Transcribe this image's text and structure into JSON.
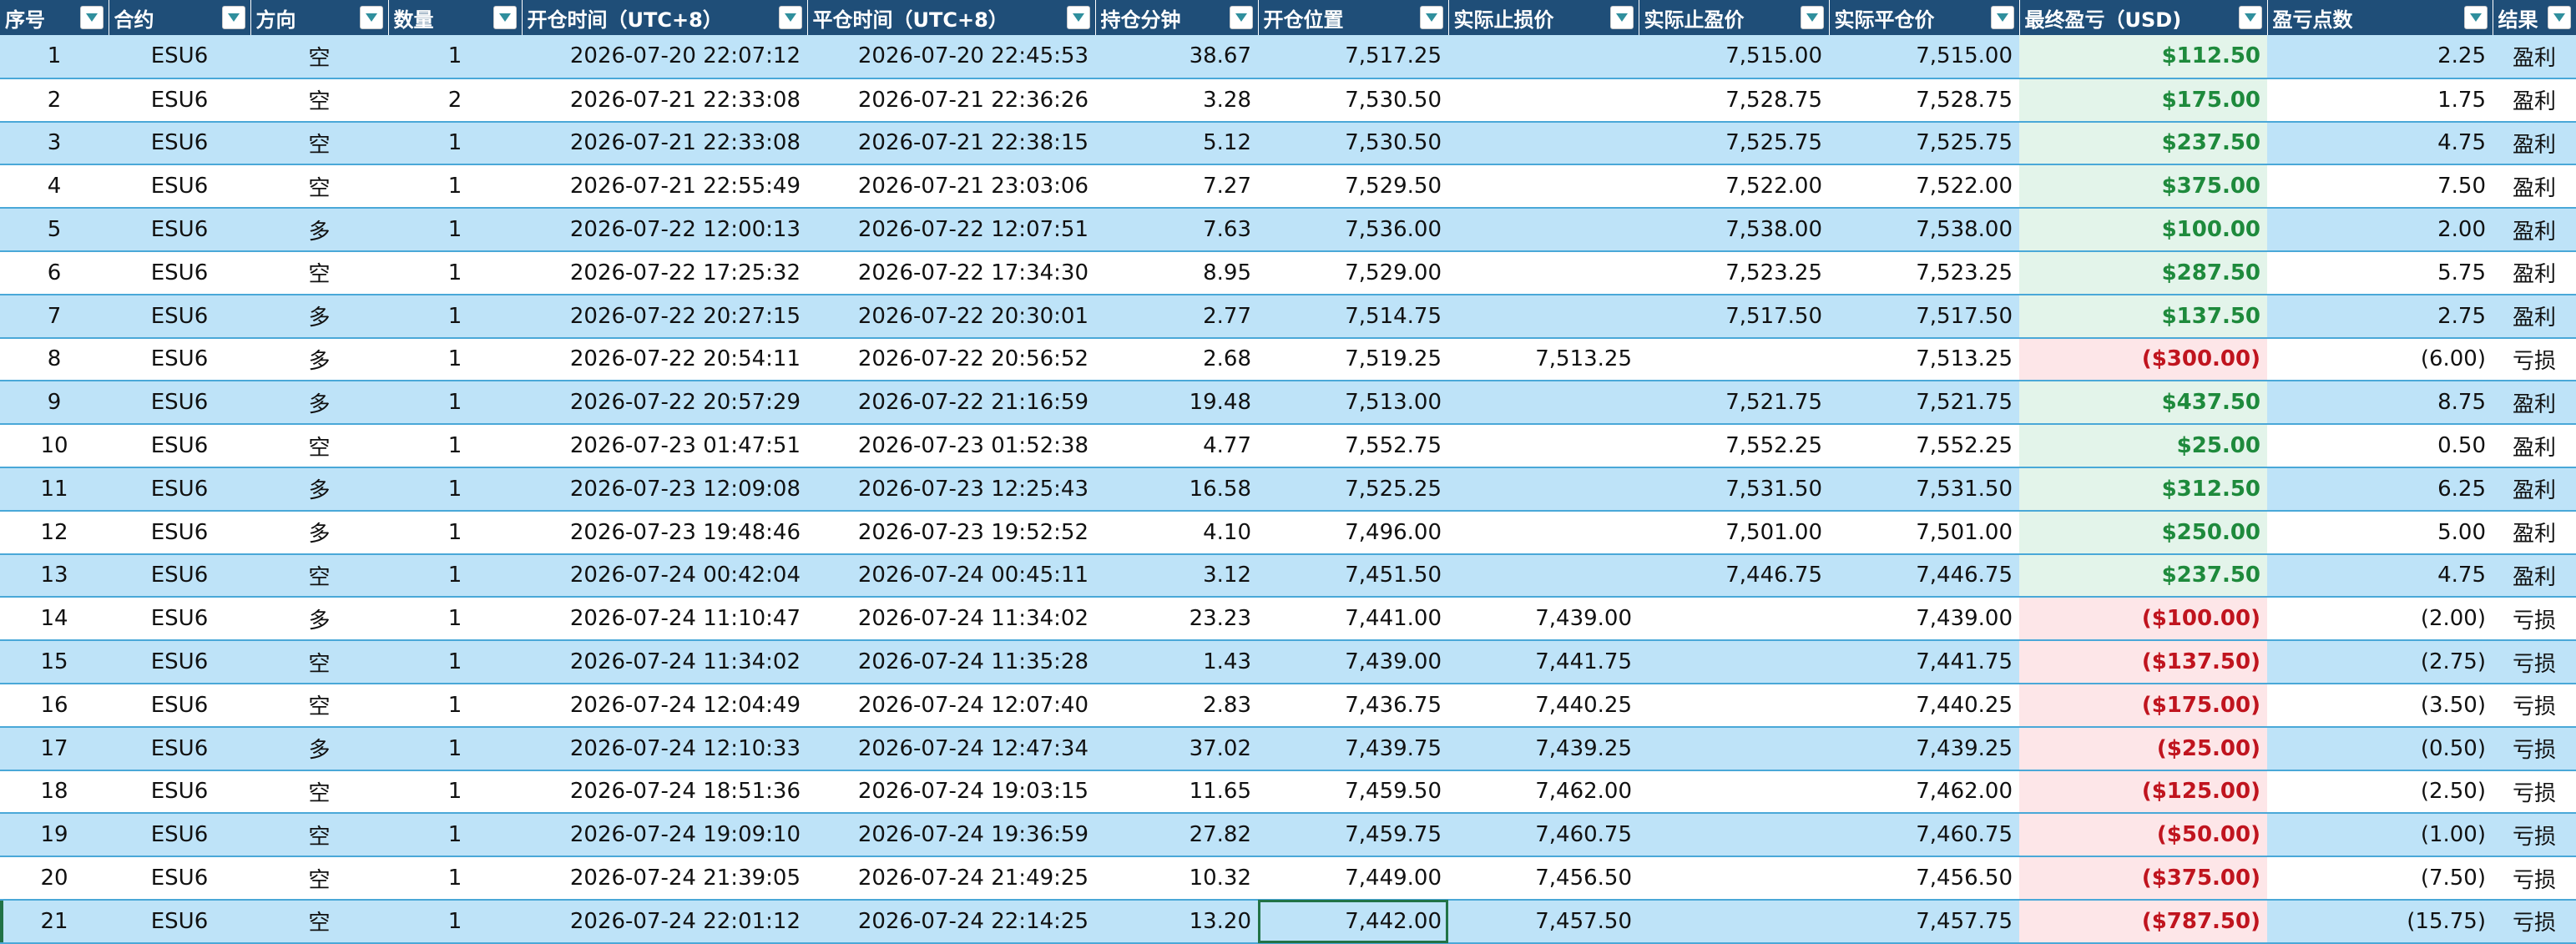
{
  "columns": [
    {
      "key": "seq",
      "label": "序号",
      "align": "c"
    },
    {
      "key": "contract",
      "label": "合约",
      "align": "c"
    },
    {
      "key": "direction",
      "label": "方向",
      "align": "c"
    },
    {
      "key": "qty",
      "label": "数量",
      "align": "c"
    },
    {
      "key": "open_time",
      "label": "开仓时间（UTC+8）",
      "align": "r"
    },
    {
      "key": "close_time",
      "label": "平仓时间（UTC+8）",
      "align": "r"
    },
    {
      "key": "hold_min",
      "label": "持仓分钟",
      "align": "r"
    },
    {
      "key": "open_price",
      "label": "开仓位置",
      "align": "r"
    },
    {
      "key": "stop_loss",
      "label": "实际止损价",
      "align": "r"
    },
    {
      "key": "take_profit",
      "label": "实际止盈价",
      "align": "r"
    },
    {
      "key": "close_price",
      "label": "实际平仓价",
      "align": "r"
    },
    {
      "key": "pnl",
      "label": "最终盈亏（USD)",
      "align": "r"
    },
    {
      "key": "pts",
      "label": "盈亏点数",
      "align": "r"
    },
    {
      "key": "result",
      "label": "结果",
      "align": "c"
    }
  ],
  "rows": [
    {
      "seq": "1",
      "contract": "ESU6",
      "direction": "空",
      "qty": "1",
      "open_time": "2026-07-20 22:07:12",
      "close_time": "2026-07-20 22:45:53",
      "hold_min": "38.67",
      "open_price": "7,517.25",
      "stop_loss": "",
      "take_profit": "7,515.00",
      "close_price": "7,515.00",
      "pnl": "$112.50",
      "pts": "2.25",
      "result": "盈利"
    },
    {
      "seq": "2",
      "contract": "ESU6",
      "direction": "空",
      "qty": "2",
      "open_time": "2026-07-21 22:33:08",
      "close_time": "2026-07-21 22:36:26",
      "hold_min": "3.28",
      "open_price": "7,530.50",
      "stop_loss": "",
      "take_profit": "7,528.75",
      "close_price": "7,528.75",
      "pnl": "$175.00",
      "pts": "1.75",
      "result": "盈利"
    },
    {
      "seq": "3",
      "contract": "ESU6",
      "direction": "空",
      "qty": "1",
      "open_time": "2026-07-21 22:33:08",
      "close_time": "2026-07-21 22:38:15",
      "hold_min": "5.12",
      "open_price": "7,530.50",
      "stop_loss": "",
      "take_profit": "7,525.75",
      "close_price": "7,525.75",
      "pnl": "$237.50",
      "pts": "4.75",
      "result": "盈利"
    },
    {
      "seq": "4",
      "contract": "ESU6",
      "direction": "空",
      "qty": "1",
      "open_time": "2026-07-21 22:55:49",
      "close_time": "2026-07-21 23:03:06",
      "hold_min": "7.27",
      "open_price": "7,529.50",
      "stop_loss": "",
      "take_profit": "7,522.00",
      "close_price": "7,522.00",
      "pnl": "$375.00",
      "pts": "7.50",
      "result": "盈利"
    },
    {
      "seq": "5",
      "contract": "ESU6",
      "direction": "多",
      "qty": "1",
      "open_time": "2026-07-22 12:00:13",
      "close_time": "2026-07-22 12:07:51",
      "hold_min": "7.63",
      "open_price": "7,536.00",
      "stop_loss": "",
      "take_profit": "7,538.00",
      "close_price": "7,538.00",
      "pnl": "$100.00",
      "pts": "2.00",
      "result": "盈利"
    },
    {
      "seq": "6",
      "contract": "ESU6",
      "direction": "空",
      "qty": "1",
      "open_time": "2026-07-22 17:25:32",
      "close_time": "2026-07-22 17:34:30",
      "hold_min": "8.95",
      "open_price": "7,529.00",
      "stop_loss": "",
      "take_profit": "7,523.25",
      "close_price": "7,523.25",
      "pnl": "$287.50",
      "pts": "5.75",
      "result": "盈利"
    },
    {
      "seq": "7",
      "contract": "ESU6",
      "direction": "多",
      "qty": "1",
      "open_time": "2026-07-22 20:27:15",
      "close_time": "2026-07-22 20:30:01",
      "hold_min": "2.77",
      "open_price": "7,514.75",
      "stop_loss": "",
      "take_profit": "7,517.50",
      "close_price": "7,517.50",
      "pnl": "$137.50",
      "pts": "2.75",
      "result": "盈利"
    },
    {
      "seq": "8",
      "contract": "ESU6",
      "direction": "多",
      "qty": "1",
      "open_time": "2026-07-22 20:54:11",
      "close_time": "2026-07-22 20:56:52",
      "hold_min": "2.68",
      "open_price": "7,519.25",
      "stop_loss": "7,513.25",
      "take_profit": "",
      "close_price": "7,513.25",
      "pnl": "($300.00)",
      "pts": "(6.00)",
      "result": "亏损"
    },
    {
      "seq": "9",
      "contract": "ESU6",
      "direction": "多",
      "qty": "1",
      "open_time": "2026-07-22 20:57:29",
      "close_time": "2026-07-22 21:16:59",
      "hold_min": "19.48",
      "open_price": "7,513.00",
      "stop_loss": "",
      "take_profit": "7,521.75",
      "close_price": "7,521.75",
      "pnl": "$437.50",
      "pts": "8.75",
      "result": "盈利"
    },
    {
      "seq": "10",
      "contract": "ESU6",
      "direction": "空",
      "qty": "1",
      "open_time": "2026-07-23 01:47:51",
      "close_time": "2026-07-23 01:52:38",
      "hold_min": "4.77",
      "open_price": "7,552.75",
      "stop_loss": "",
      "take_profit": "7,552.25",
      "close_price": "7,552.25",
      "pnl": "$25.00",
      "pts": "0.50",
      "result": "盈利"
    },
    {
      "seq": "11",
      "contract": "ESU6",
      "direction": "多",
      "qty": "1",
      "open_time": "2026-07-23 12:09:08",
      "close_time": "2026-07-23 12:25:43",
      "hold_min": "16.58",
      "open_price": "7,525.25",
      "stop_loss": "",
      "take_profit": "7,531.50",
      "close_price": "7,531.50",
      "pnl": "$312.50",
      "pts": "6.25",
      "result": "盈利"
    },
    {
      "seq": "12",
      "contract": "ESU6",
      "direction": "多",
      "qty": "1",
      "open_time": "2026-07-23 19:48:46",
      "close_time": "2026-07-23 19:52:52",
      "hold_min": "4.10",
      "open_price": "7,496.00",
      "stop_loss": "",
      "take_profit": "7,501.00",
      "close_price": "7,501.00",
      "pnl": "$250.00",
      "pts": "5.00",
      "result": "盈利"
    },
    {
      "seq": "13",
      "contract": "ESU6",
      "direction": "空",
      "qty": "1",
      "open_time": "2026-07-24 00:42:04",
      "close_time": "2026-07-24 00:45:11",
      "hold_min": "3.12",
      "open_price": "7,451.50",
      "stop_loss": "",
      "take_profit": "7,446.75",
      "close_price": "7,446.75",
      "pnl": "$237.50",
      "pts": "4.75",
      "result": "盈利"
    },
    {
      "seq": "14",
      "contract": "ESU6",
      "direction": "多",
      "qty": "1",
      "open_time": "2026-07-24 11:10:47",
      "close_time": "2026-07-24 11:34:02",
      "hold_min": "23.23",
      "open_price": "7,441.00",
      "stop_loss": "7,439.00",
      "take_profit": "",
      "close_price": "7,439.00",
      "pnl": "($100.00)",
      "pts": "(2.00)",
      "result": "亏损"
    },
    {
      "seq": "15",
      "contract": "ESU6",
      "direction": "空",
      "qty": "1",
      "open_time": "2026-07-24 11:34:02",
      "close_time": "2026-07-24 11:35:28",
      "hold_min": "1.43",
      "open_price": "7,439.00",
      "stop_loss": "7,441.75",
      "take_profit": "",
      "close_price": "7,441.75",
      "pnl": "($137.50)",
      "pts": "(2.75)",
      "result": "亏损"
    },
    {
      "seq": "16",
      "contract": "ESU6",
      "direction": "空",
      "qty": "1",
      "open_time": "2026-07-24 12:04:49",
      "close_time": "2026-07-24 12:07:40",
      "hold_min": "2.83",
      "open_price": "7,436.75",
      "stop_loss": "7,440.25",
      "take_profit": "",
      "close_price": "7,440.25",
      "pnl": "($175.00)",
      "pts": "(3.50)",
      "result": "亏损"
    },
    {
      "seq": "17",
      "contract": "ESU6",
      "direction": "多",
      "qty": "1",
      "open_time": "2026-07-24 12:10:33",
      "close_time": "2026-07-24 12:47:34",
      "hold_min": "37.02",
      "open_price": "7,439.75",
      "stop_loss": "7,439.25",
      "take_profit": "",
      "close_price": "7,439.25",
      "pnl": "($25.00)",
      "pts": "(0.50)",
      "result": "亏损"
    },
    {
      "seq": "18",
      "contract": "ESU6",
      "direction": "空",
      "qty": "1",
      "open_time": "2026-07-24 18:51:36",
      "close_time": "2026-07-24 19:03:15",
      "hold_min": "11.65",
      "open_price": "7,459.50",
      "stop_loss": "7,462.00",
      "take_profit": "",
      "close_price": "7,462.00",
      "pnl": "($125.00)",
      "pts": "(2.50)",
      "result": "亏损"
    },
    {
      "seq": "19",
      "contract": "ESU6",
      "direction": "空",
      "qty": "1",
      "open_time": "2026-07-24 19:09:10",
      "close_time": "2026-07-24 19:36:59",
      "hold_min": "27.82",
      "open_price": "7,459.75",
      "stop_loss": "7,460.75",
      "take_profit": "",
      "close_price": "7,460.75",
      "pnl": "($50.00)",
      "pts": "(1.00)",
      "result": "亏损"
    },
    {
      "seq": "20",
      "contract": "ESU6",
      "direction": "空",
      "qty": "1",
      "open_time": "2026-07-24 21:39:05",
      "close_time": "2026-07-24 21:49:25",
      "hold_min": "10.32",
      "open_price": "7,449.00",
      "stop_loss": "7,456.50",
      "take_profit": "",
      "close_price": "7,456.50",
      "pnl": "($375.00)",
      "pts": "(7.50)",
      "result": "亏损"
    },
    {
      "seq": "21",
      "contract": "ESU6",
      "direction": "空",
      "qty": "1",
      "open_time": "2026-07-24 22:01:12",
      "close_time": "2026-07-24 22:14:25",
      "hold_min": "13.20",
      "open_price": "7,442.00",
      "stop_loss": "7,457.50",
      "take_profit": "",
      "close_price": "7,457.75",
      "pnl": "($787.50)",
      "pts": "(15.75)",
      "result": "亏损"
    }
  ],
  "selection": {
    "row": 20,
    "column": "open_price"
  },
  "colors": {
    "header_bg": "#1f4e78",
    "header_text": "#ffffff",
    "band_blue": "#bee3f8",
    "profit_green": "#1e8a3c",
    "loss_red": "#c0141e",
    "selection_border": "#217346"
  },
  "icons": {
    "filter": "filter-dropdown-icon"
  }
}
